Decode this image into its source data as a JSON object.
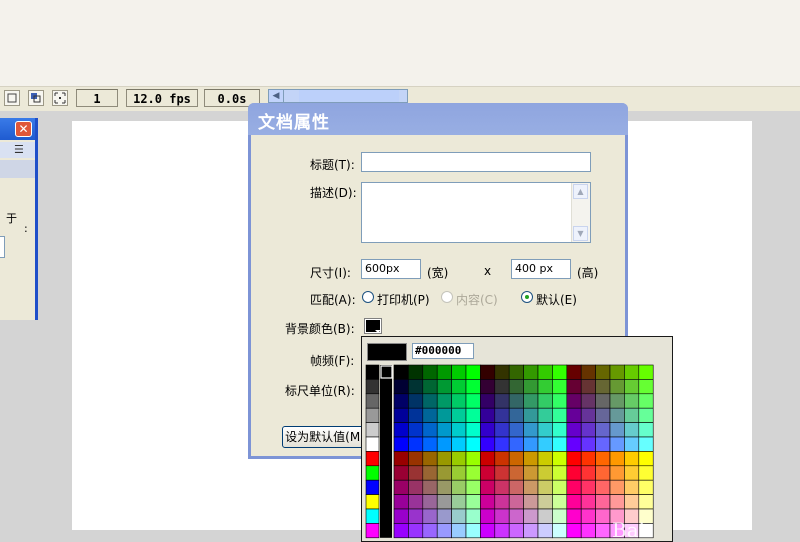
{
  "timeline": {
    "frame": "1",
    "fps": "12.0 fps",
    "time": "0.0s",
    "icons": [
      "onion-skin-icon",
      "onion-outline-icon",
      "edit-multiple-frames-icon",
      "onion-markers-icon"
    ]
  },
  "left_panel": {
    "close_icon": "close-icon",
    "menu_icon": "options-menu-icon",
    "text1": "于",
    "text2": ":"
  },
  "dialog": {
    "title": "文档属性",
    "title_label": "标题(T):",
    "title_value": "",
    "desc_label": "描述(D):",
    "desc_value": "",
    "size_label": "尺寸(I):",
    "width_value": "600px",
    "width_unit": "(宽)",
    "times": "x",
    "height_value": "400 px",
    "height_unit": "(高)",
    "match_label": "匹配(A):",
    "match_options": [
      {
        "label": "打印机(P)",
        "selected": false,
        "disabled": false
      },
      {
        "label": "内容(C)",
        "selected": false,
        "disabled": true
      },
      {
        "label": "默认(E)",
        "selected": true,
        "disabled": false
      }
    ],
    "bg_color_label": "背景颜色(B):",
    "bg_color": "#000000",
    "fps_label": "帧频(F):",
    "ruler_label": "标尺单位(R):",
    "default_button": "设为默认值(M)"
  },
  "palette": {
    "hex_value": "#000000",
    "preview_color": "#000000",
    "left_column_colors": [
      "#000000",
      "#333333",
      "#666666",
      "#999999",
      "#cccccc",
      "#ffffff",
      "#ff0000",
      "#00ff00",
      "#0000ff",
      "#ffff00",
      "#00ffff",
      "#ff00ff"
    ]
  },
  "watermark": "Bai"
}
